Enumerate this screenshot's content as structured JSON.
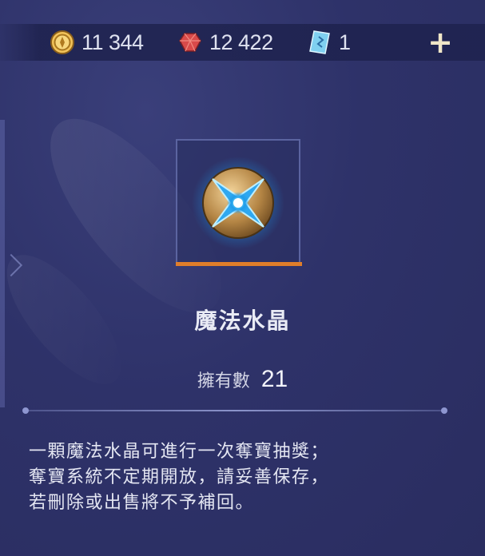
{
  "currencies": {
    "gold": {
      "icon": "gold-coin-icon",
      "value": "11 344"
    },
    "gem": {
      "icon": "red-gem-icon",
      "value": "12 422"
    },
    "ticket": {
      "icon": "blue-ticket-icon",
      "value": "1"
    },
    "add_label": "+"
  },
  "item": {
    "icon": "magic-crystal-icon",
    "name": "魔法水晶",
    "owned_label": "擁有數",
    "owned_count": "21",
    "description": [
      "一顆魔法水晶可進行一次奪寶抽獎；",
      "奪寶系統不定期開放，請妥善保存，",
      "若刪除或出售將不予補回。"
    ]
  },
  "colors": {
    "background": "#2e3269",
    "rarity_bar": "#e07e2a",
    "frame_border": "#5b64a0"
  }
}
